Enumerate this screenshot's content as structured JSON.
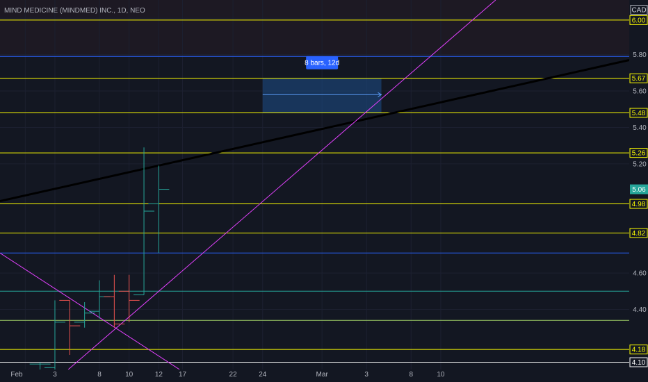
{
  "chart_data": {
    "type": "ohlc",
    "title": "MIND MEDICINE (MINDMED) INC., 1D, NEO",
    "currency": "CAD",
    "ylim": [
      4.07,
      6.1
    ],
    "x_index_range": [
      -3.7,
      38.7
    ],
    "x_ticks": [
      {
        "i": -2,
        "label": "Feb"
      },
      {
        "i": 0,
        "label": "3"
      },
      {
        "i": 3,
        "label": "8"
      },
      {
        "i": 5,
        "label": "10"
      },
      {
        "i": 7,
        "label": "12"
      },
      {
        "i": 8.6,
        "label": "17"
      },
      {
        "i": 12,
        "label": "22"
      },
      {
        "i": 14,
        "label": "24"
      },
      {
        "i": 18,
        "label": "Mar"
      },
      {
        "i": 21,
        "label": "3"
      },
      {
        "i": 24,
        "label": "8"
      },
      {
        "i": 26,
        "label": "10"
      }
    ],
    "y_ticks": [
      "6.00",
      "5.80",
      "5.60",
      "5.40",
      "5.20",
      "4.60",
      "4.40"
    ],
    "colors": {
      "background": "#131722",
      "up": "#26a69a",
      "down": "#ef5350",
      "level": "#ffff00",
      "blue_line": "#2962ff",
      "magenta": "#e040fb",
      "trend_black": "#000000",
      "measure_fill": "#1e4f8a",
      "measure_badge": "#2962ff",
      "last_price": "#26a69a"
    },
    "bars": [
      {
        "i": -1,
        "open": 4.1,
        "high": 4.11,
        "low": 4.07,
        "close": 4.1
      },
      {
        "i": 0,
        "open": 4.08,
        "high": 4.45,
        "low": 4.07,
        "close": 4.33
      },
      {
        "i": 1,
        "open": 4.45,
        "high": 4.45,
        "low": 4.15,
        "close": 4.31
      },
      {
        "i": 2,
        "open": 4.33,
        "high": 4.44,
        "low": 4.3,
        "close": 4.38
      },
      {
        "i": 3,
        "open": 4.39,
        "high": 4.56,
        "low": 4.35,
        "close": 4.47
      },
      {
        "i": 4,
        "open": 4.47,
        "high": 4.59,
        "low": 4.3,
        "close": 4.32
      },
      {
        "i": 5,
        "open": 4.5,
        "high": 4.59,
        "low": 4.33,
        "close": 4.45
      },
      {
        "i": 6,
        "open": 4.48,
        "high": 5.29,
        "low": 4.48,
        "close": 4.94
      },
      {
        "i": 7,
        "open": 4.98,
        "high": 5.19,
        "low": 4.71,
        "close": 5.06
      }
    ],
    "levels": [
      {
        "name": "level-6",
        "value": 5.99,
        "color": "#ffff00",
        "label": "6.00"
      },
      {
        "name": "level-5.80",
        "value": 5.79,
        "color": "#2962ff",
        "label": ""
      },
      {
        "name": "level-5.67",
        "value": 5.67,
        "color": "#ffff00",
        "label": "5.67"
      },
      {
        "name": "level-5.48",
        "value": 5.48,
        "color": "#ffff00",
        "label": "5.48"
      },
      {
        "name": "level-5.26",
        "value": 5.26,
        "color": "#ffff00",
        "label": "5.26"
      },
      {
        "name": "level-4.98",
        "value": 4.98,
        "color": "#ffff00",
        "label": "4.98"
      },
      {
        "name": "level-4.82",
        "value": 4.82,
        "color": "#ffff00",
        "label": "4.82"
      },
      {
        "name": "level-4.71",
        "value": 4.71,
        "color": "#2962ff",
        "label": ""
      },
      {
        "name": "level-4.50",
        "value": 4.5,
        "color": "#26a69a",
        "label": ""
      },
      {
        "name": "level-4.34",
        "value": 4.34,
        "color": "#9ccc65",
        "label": ""
      },
      {
        "name": "level-4.18",
        "value": 4.18,
        "color": "#ffff00",
        "label": "4.18"
      },
      {
        "name": "level-4.10",
        "value": 4.11,
        "color": "#ffffff",
        "label": "4.10"
      }
    ],
    "trendlines": [
      {
        "name": "trendline-black",
        "color": "#000000",
        "width": 3,
        "from": {
          "i": -3.7,
          "price": 4.995
        },
        "to": {
          "i": 38.7,
          "price": 5.77
        }
      },
      {
        "name": "trendline-magenta-up",
        "color": "#e040fb",
        "width": 1,
        "from": {
          "i": 0.9,
          "price": 4.07
        },
        "to": {
          "i": 29.7,
          "price": 6.1
        }
      },
      {
        "name": "trendline-magenta-down",
        "color": "#e040fb",
        "width": 1,
        "from": {
          "i": -3.7,
          "price": 4.71
        },
        "to": {
          "i": 8.4,
          "price": 4.07
        }
      }
    ],
    "measure": {
      "label": "8 bars, 12d",
      "from": {
        "i": 14,
        "price": 5.48
      },
      "to": {
        "i": 22,
        "price": 5.67
      },
      "arrow_price": 5.58
    },
    "last_price": {
      "value": 5.06,
      "label": "5.06"
    }
  }
}
